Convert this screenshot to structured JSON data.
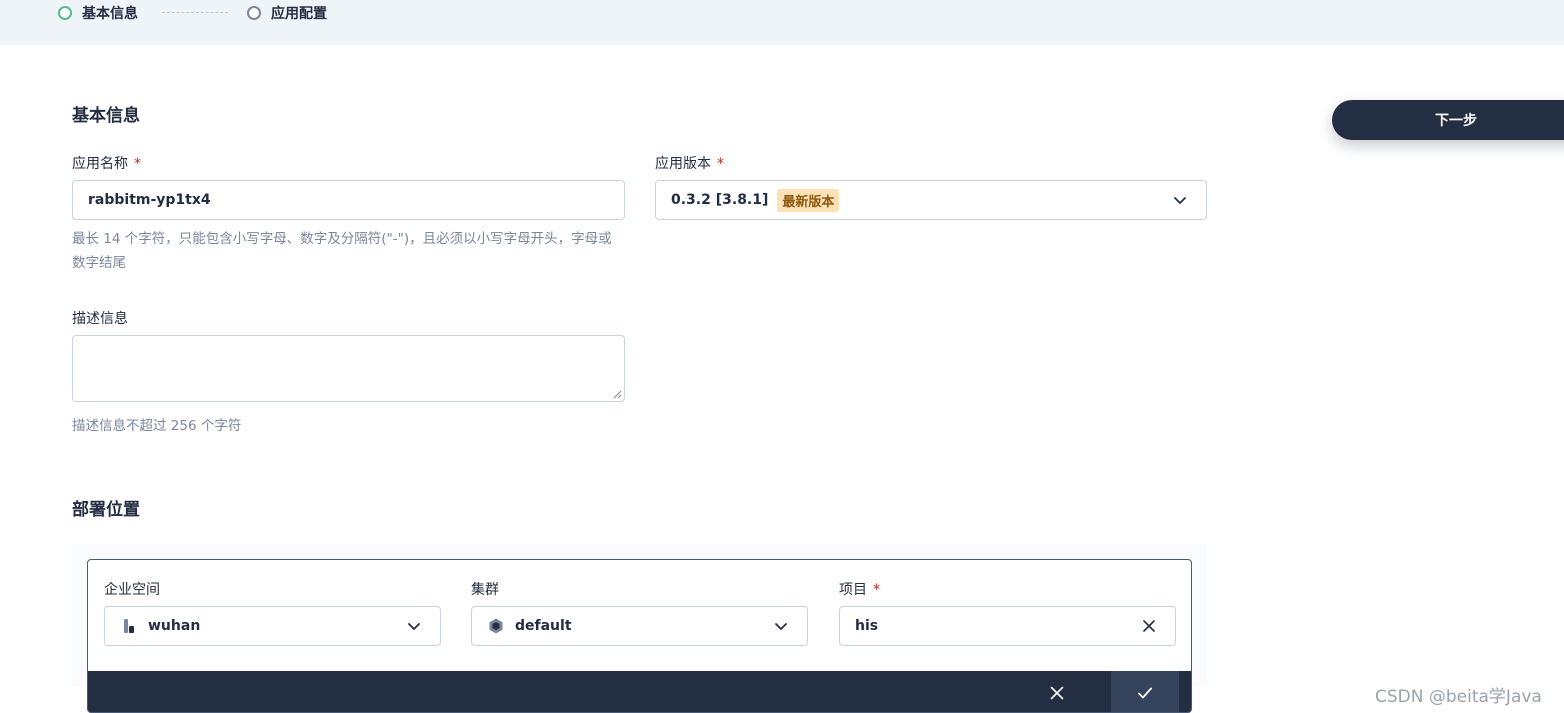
{
  "steps": [
    {
      "label": "基本信息",
      "state": "active"
    },
    {
      "label": "应用配置",
      "state": "pending"
    }
  ],
  "basic_info": {
    "title": "基本信息",
    "app_name": {
      "label": "应用名称",
      "required": "*",
      "value": "rabbitm-yp1tx4",
      "hint": "最长 14 个字符，只能包含小写字母、数字及分隔符(\"-\")，且必须以小写字母开头，字母或数字结尾"
    },
    "app_version": {
      "label": "应用版本",
      "required": "*",
      "value": "0.3.2 [3.8.1]",
      "tag": "最新版本"
    },
    "description": {
      "label": "描述信息",
      "value": "",
      "hint": "描述信息不超过 256 个字符"
    }
  },
  "next_button": {
    "label": "下一步"
  },
  "placement": {
    "title": "部署位置",
    "workspace": {
      "label": "企业空间",
      "value": "wuhan",
      "icon": "workspace-icon"
    },
    "cluster": {
      "label": "集群",
      "value": "default",
      "icon": "cluster-icon"
    },
    "project": {
      "label": "项目",
      "required": "*",
      "value": "his"
    }
  },
  "watermark": "CSDN @beita学Java",
  "colors": {
    "accent_dark": "#242e42",
    "active_step": "#55bc8a",
    "required": "#ca2621",
    "tag_bg": "#fbe1b6"
  }
}
